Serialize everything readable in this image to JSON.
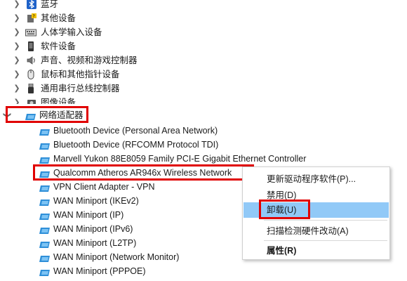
{
  "tree": {
    "categories": [
      {
        "label": "蓝牙",
        "icon": "bluetooth-icon"
      },
      {
        "label": "其他设备",
        "icon": "unknown-device-icon"
      },
      {
        "label": "人体学输入设备",
        "icon": "keyboard-icon"
      },
      {
        "label": "软件设备",
        "icon": "software-device-icon"
      },
      {
        "label": "声音、视频和游戏控制器",
        "icon": "speaker-icon"
      },
      {
        "label": "鼠标和其他指针设备",
        "icon": "mouse-icon"
      },
      {
        "label": "通用串行总线控制器",
        "icon": "usb-icon"
      },
      {
        "label": "图像设备",
        "icon": "camera-icon"
      }
    ],
    "network_adapters": {
      "label": "网络适配器",
      "icon": "network-adapter-icon",
      "expanded": true,
      "children": [
        "Bluetooth Device (Personal Area Network)",
        "Bluetooth Device (RFCOMM Protocol TDI)",
        "Marvell Yukon 88E8059 Family PCI-E Gigabit Ethernet Controller",
        "Qualcomm Atheros AR946x Wireless Network",
        "VPN Client Adapter - VPN",
        "WAN Miniport (IKEv2)",
        "WAN Miniport (IP)",
        "WAN Miniport (IPv6)",
        "WAN Miniport (L2TP)",
        "WAN Miniport (Network Monitor)",
        "WAN Miniport (PPPOE)"
      ],
      "selected_index": 3
    }
  },
  "context_menu": {
    "items": [
      "更新驱动程序软件(P)...",
      "禁用(D)",
      "卸载(U)",
      "扫描检测硬件改动(A)",
      "属性(R)"
    ],
    "highlighted_index": 2
  },
  "colors": {
    "annotation_red": "#e00000",
    "menu_highlight": "#91c9f7",
    "network_icon": "#2f8fd8"
  }
}
